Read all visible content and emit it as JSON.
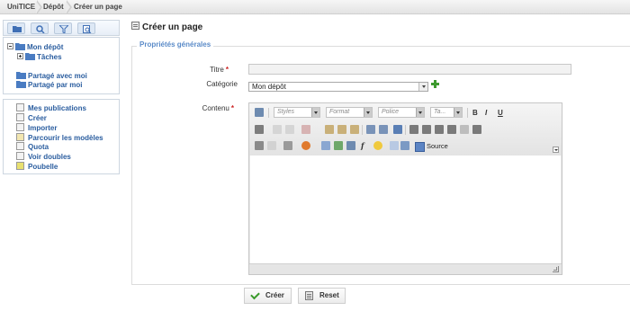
{
  "breadcrumb": [
    "UniTICE",
    "Dépôt",
    "Créer un page"
  ],
  "sidebar": {
    "tree": [
      {
        "label": "Mon dépôt"
      },
      {
        "label": "Tâches"
      },
      {
        "label": "Partagé avec moi"
      },
      {
        "label": "Partagé par moi"
      }
    ],
    "actions": [
      {
        "label": "Mes publications"
      },
      {
        "label": "Créer"
      },
      {
        "label": "Importer"
      },
      {
        "label": "Parcourir les modèles"
      },
      {
        "label": "Quota"
      },
      {
        "label": "Voir doubles"
      },
      {
        "label": "Poubelle"
      }
    ]
  },
  "main": {
    "title": "Créer un page",
    "legend": "Propriétés générales",
    "fields": {
      "title_label": "Titre",
      "title_value": "",
      "category_label": "Catégorie",
      "category_value": "Mon dépôt",
      "content_label": "Contenu",
      "required_mark": "*"
    },
    "editor": {
      "styles_placeholder": "Styles",
      "format_placeholder": "Format",
      "font_placeholder": "Police",
      "size_placeholder": "Ta...",
      "bold": "B",
      "italic": "I",
      "underline": "U",
      "source_label": "Source"
    },
    "buttons": {
      "create_label": "Créer",
      "reset_label": "Reset"
    }
  },
  "colors": {
    "link_blue": "#2a5d9f",
    "legend_blue": "#5b8bc8",
    "required_red": "#cc2222",
    "add_green": "#3d9a2f"
  }
}
